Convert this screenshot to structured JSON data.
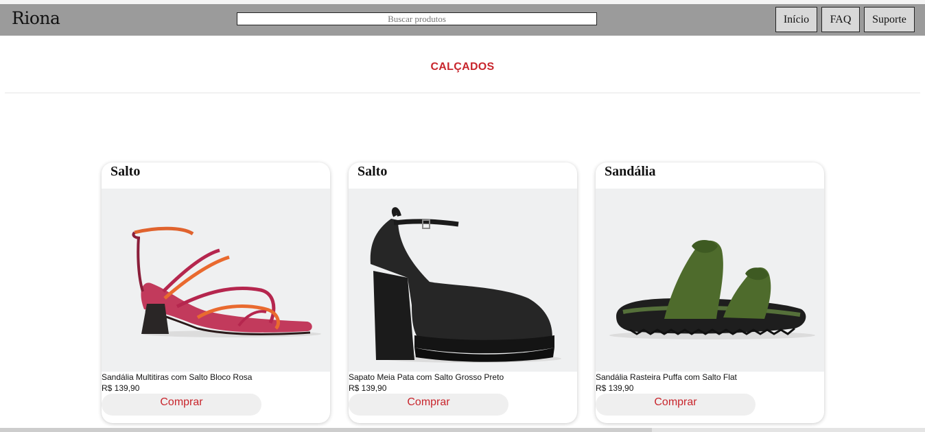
{
  "header": {
    "brand": "Riona",
    "search_placeholder": "Buscar produtos",
    "nav": [
      "Início",
      "FAQ",
      "Suporte"
    ]
  },
  "section": {
    "title": "CALÇADOS"
  },
  "products": [
    {
      "category": "Salto",
      "name": "Sandália Multitiras com Salto Bloco Rosa",
      "price": "R$ 139,90",
      "buy_label": "Comprar",
      "image_icon": "pink-strappy-block-heel-sandal"
    },
    {
      "category": "Salto",
      "name": "Sapato Meia Pata com Salto Grosso Preto",
      "price": "R$ 139,90",
      "buy_label": "Comprar",
      "image_icon": "black-platform-heel-shoe"
    },
    {
      "category": "Sandália",
      "name": "Sandália Rasteira Puffa com Salto Flat",
      "price": "R$ 139,90",
      "buy_label": "Comprar",
      "image_icon": "green-puffy-flat-sandal"
    }
  ],
  "colors": {
    "navbar": "#9b9b9b",
    "accent_red": "#c8252c",
    "image_bg": "#eff0f1"
  }
}
